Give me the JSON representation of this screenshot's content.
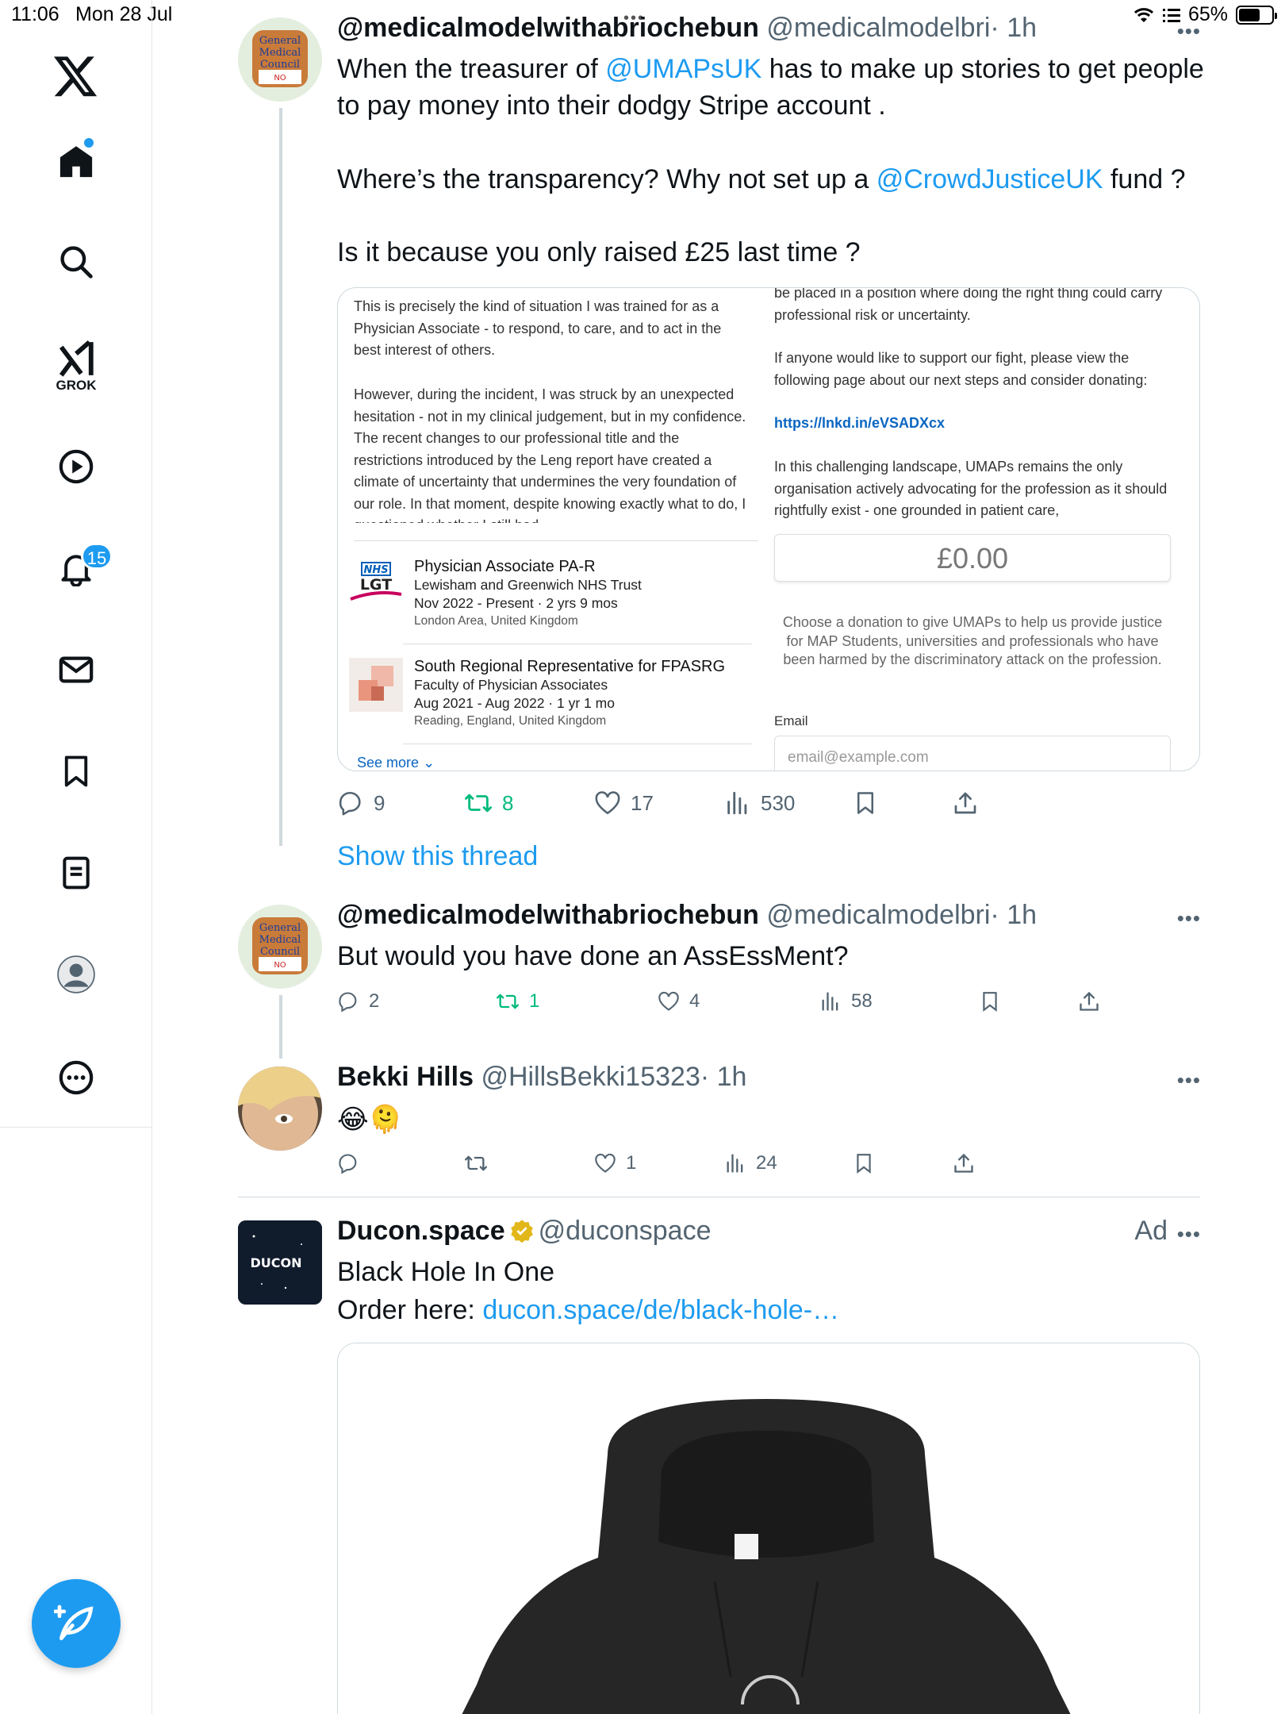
{
  "status_bar": {
    "time": "11:06",
    "date": "Mon 28 Jul",
    "battery": "65%"
  },
  "sidebar": {
    "notifications_badge": "15",
    "grok_label": "GROK"
  },
  "tweet1": {
    "name": "@medicalmodelwithabriochebun",
    "handle": "@medicalmodelbri",
    "time": "· 1h",
    "text_1a": "When the treasurer of ",
    "mention_1": "@UMAPsUK",
    "text_1b": " has to make up stories to get people to pay money into their dodgy Stripe account .",
    "text_2a": "Where’s the transparency? Why not set up a ",
    "mention_2": "@CrowdJusticeUK",
    "text_2b": " fund ?",
    "text_3": "Is it because you only raised £25 last time ?",
    "media": {
      "left_para_1": "This is precisely the kind of situation I was trained for as a Physician Associate - to respond, to care, and to act in the best interest of others.",
      "left_para_2": "However, during the incident, I was struck by an unexpected hesitation - not in my clinical judgement, but in my confidence. The recent changes to our professional title and the restrictions introduced by the Leng report have created a climate of uncertainty that undermines the very foundation of our role. In that moment, despite knowing exactly what to do, I questioned whether I still had",
      "experience": [
        {
          "title": "Physician Associate PA-R",
          "org": "Lewisham and Greenwich NHS Trust",
          "dates": "Nov 2022 - Present  ·  2 yrs 9 mos",
          "location": "London Area, United Kingdom",
          "logo_text_1": "NHS",
          "logo_text_2": "LGT"
        },
        {
          "title": "South Regional Representative for FPASRG",
          "org": "Faculty of Physician Associates",
          "dates": "Aug 2021 - Aug 2022  ·  1 yr 1 mo",
          "location": "Reading, England, United Kingdom"
        }
      ],
      "see_more": "See more",
      "right_para_1": "be placed in a position where doing the right thing could carry professional risk or uncertainty.",
      "right_para_2": "If anyone would like to support our fight, please view the following page about our next steps and consider donating:",
      "right_link": "https://lnkd.in/eVSADXcx",
      "right_para_3": "In this challenging landscape, UMAPs remains the only organisation actively advocating for the profession as it should rightfully exist - one grounded in patient care,",
      "amount": "£0.00",
      "donate_text": "Choose a donation to give UMAPs to help us provide justice for MAP Students, universities and professionals who have been harmed by the discriminatory attack on the profession.",
      "email_label": "Email",
      "email_placeholder": "email@example.com"
    },
    "replies": "9",
    "retweets": "8",
    "likes": "17",
    "views": "530"
  },
  "show_thread": "Show this thread",
  "tweet2": {
    "name": "@medicalmodelwithabriochebun",
    "handle": "@medicalmodelbri",
    "time": "· 1h",
    "text": "But would you have done an AssEssMent?",
    "replies": "2",
    "retweets": "1",
    "likes": "4",
    "views": "58"
  },
  "tweet3": {
    "name": "Bekki Hills",
    "handle": "@HillsBekki15323",
    "time": "· 1h",
    "text": "😂🫠",
    "likes": "1",
    "views": "24"
  },
  "ad": {
    "name": "Ducon.space",
    "handle": "@duconspace",
    "ad_label": "Ad",
    "text_1": "Black Hole In One",
    "text_2a": "Order here: ",
    "link": "ducon.space/de/black-hole-…",
    "avatar_text": "DUCON"
  },
  "colors": {
    "accent": "#1d9bf0",
    "retweet_green": "#00ba7c",
    "text_gray": "#536471"
  }
}
